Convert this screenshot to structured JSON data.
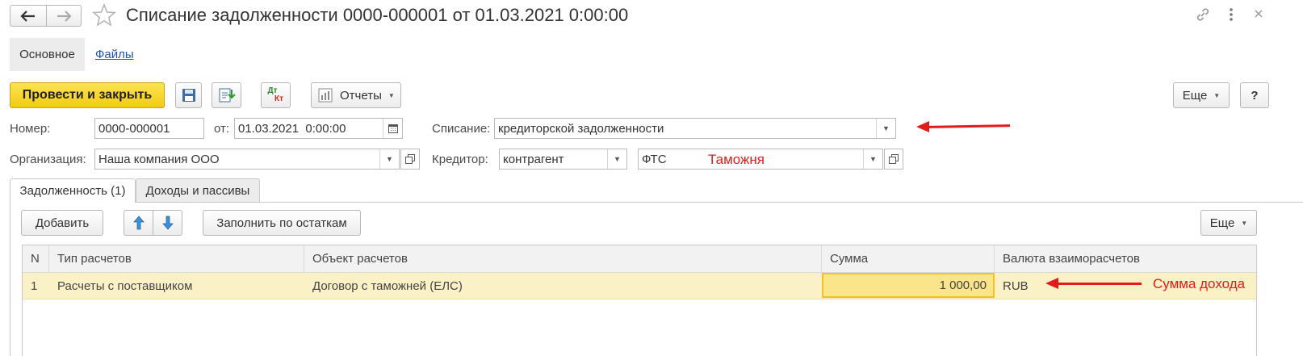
{
  "window": {
    "title": "Списание задолженности 0000-000001 от 01.03.2021 0:00:00"
  },
  "nav_tabs": [
    "Основное",
    "Файлы"
  ],
  "toolbar": {
    "post_close_label": "Провести и закрыть",
    "dtkt_top": "Дт",
    "dtkt_bottom": "Кт",
    "reports_label": "Отчеты",
    "more_label": "Еще",
    "help_label": "?"
  },
  "form": {
    "number_label": "Номер:",
    "number_value": "0000-000001",
    "date_label": "от:",
    "date_value": "01.03.2021  0:00:00",
    "writeoff_label": "Списание:",
    "writeoff_value": "кредиторской задолженности",
    "org_label": "Организация:",
    "org_value": "Наша компания ООО",
    "creditor_label": "Кредитор:",
    "creditor_type": "контрагент",
    "creditor_value": "ФТС"
  },
  "doc_tabs": [
    "Задолженность (1)",
    "Доходы и пассивы"
  ],
  "table_toolbar": {
    "add_label": "Добавить",
    "fill_label": "Заполнить по остаткам",
    "more_label": "Еще"
  },
  "table": {
    "columns": [
      "N",
      "Тип расчетов",
      "Объект расчетов",
      "Сумма",
      "Валюта взаиморасчетов"
    ],
    "rows": [
      {
        "n": "1",
        "type": "Расчеты с поставщиком",
        "object": "Договор с таможней (ЕЛС)",
        "amount": "1 000,00",
        "currency": "RUB"
      }
    ]
  },
  "annotations": {
    "customs": "Таможня",
    "income_sum": "Сумма дохода"
  },
  "colors": {
    "primary_button": "#f2cb11",
    "row_highlight": "#fbf1c7",
    "amount_cell": "#fae58b",
    "link": "#1a56b0",
    "annotation": "#e31b1b"
  }
}
